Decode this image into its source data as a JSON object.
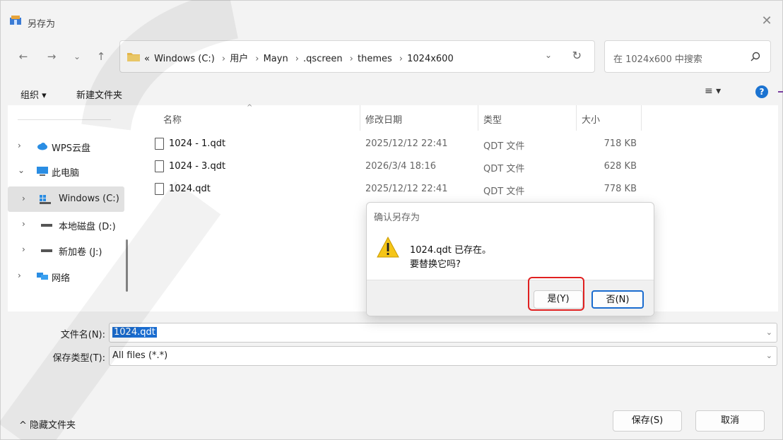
{
  "window": {
    "title": "另存为",
    "close_glyph": "✕"
  },
  "nav": {
    "back": "←",
    "forward": "→",
    "recent": "⌄",
    "up": "↑",
    "breadcrumb_overflow": "«",
    "breadcrumbs": [
      "Windows (C:)",
      "用户",
      "Mayn",
      ".qscreen",
      "themes",
      "1024x600"
    ],
    "separator": "›",
    "dropdown": "⌄",
    "refresh": "↻",
    "search_placeholder": "在 1024x600 中搜索"
  },
  "toolbar": {
    "organize": "组织 ▾",
    "new_folder": "新建文件夹",
    "view": "≡ ▾",
    "help": "?"
  },
  "sidebar": {
    "items": [
      {
        "chevron": "›",
        "label": "WPS云盘",
        "icon": "cloud-icon",
        "selected": false
      },
      {
        "chevron": "⌄",
        "label": "此电脑",
        "icon": "computer-icon",
        "selected": false
      },
      {
        "chevron": "›",
        "label": "Windows (C:)",
        "icon": "windows-drive-icon",
        "selected": true
      },
      {
        "chevron": "›",
        "label": "本地磁盘 (D:)",
        "icon": "drive-icon",
        "selected": false
      },
      {
        "chevron": "›",
        "label": "新加卷 (J:)",
        "icon": "drive-icon",
        "selected": false
      },
      {
        "chevron": "›",
        "label": "网络",
        "icon": "network-icon",
        "selected": false
      }
    ]
  },
  "files": {
    "columns": {
      "name": "名称",
      "date": "修改日期",
      "type": "类型",
      "size": "大小"
    },
    "rows": [
      {
        "name": "1024 - 1.qdt",
        "date": "2025/12/12 22:41",
        "type": "QDT 文件",
        "size": "718 KB"
      },
      {
        "name": "1024 - 3.qdt",
        "date": "2026/3/4 18:16",
        "type": "QDT 文件",
        "size": "628 KB"
      },
      {
        "name": "1024.qdt",
        "date": "2025/12/12 22:41",
        "type": "QDT 文件",
        "size": "778 KB"
      }
    ]
  },
  "fields": {
    "filename_label": "文件名(N):",
    "filename_value": "1024.qdt",
    "filetype_label": "保存类型(T):",
    "filetype_value": "All files (*.*)",
    "arrow": "⌄"
  },
  "footer": {
    "hide_folders": "^ 隐藏文件夹",
    "save": "保存(S)",
    "cancel": "取消"
  },
  "dialog": {
    "title": "确认另存为",
    "message_line1": "1024.qdt 已存在。",
    "message_line2": "要替换它吗?",
    "yes": "是(Y)",
    "no": "否(N)"
  },
  "colors": {
    "accent": "#1a6ccf",
    "highlight": "#e02020",
    "folder": "#f2c14e"
  }
}
